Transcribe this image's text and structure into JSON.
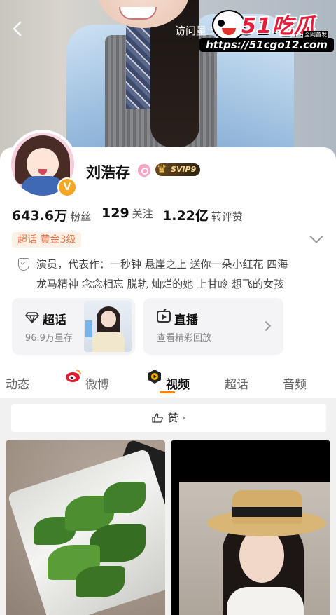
{
  "header": {
    "visits_label": "访问量 5",
    "watermark_brand": "51吃瓜",
    "watermark_tag": "全网首发",
    "watermark_url": "https://51cgo12.com"
  },
  "profile": {
    "name": "刘浩存",
    "svip": "SVIP9",
    "verified_glyph": "V",
    "stats": [
      {
        "value": "643.6万",
        "label": "粉丝"
      },
      {
        "value": "129",
        "label": "关注"
      },
      {
        "value": "1.22亿",
        "label": "转评赞"
      }
    ],
    "level_prefix": "超话",
    "level_text": "黄金3级",
    "bio_line1": "演员，代表作：一秒钟 悬崖之上 送你一朵小红花 四海",
    "bio_line2": "龙马精神 念念相忘 脱轨 灿烂的她 上甘岭 想飞的女孩"
  },
  "cards": {
    "supertopic": {
      "title": "超话",
      "sub": "96.9万星存"
    },
    "live": {
      "title": "直播",
      "sub": "查看精彩回放"
    }
  },
  "tabs": [
    {
      "label": "动态"
    },
    {
      "label": "微博"
    },
    {
      "label": "视频"
    },
    {
      "label": "超话"
    },
    {
      "label": "音频"
    }
  ],
  "like_bar": {
    "label": "赞"
  },
  "colors": {
    "accent": "#ff8200",
    "level_text": "#e8744a",
    "svip_gold": "#f8d98a"
  },
  "icons": [
    "back-icon",
    "more-icon",
    "verified-icon",
    "pink-badge-icon",
    "crown-icon",
    "bio-icon",
    "diamond-icon",
    "live-icon",
    "chevron-right-icon",
    "chevron-down-icon",
    "weibo-icon",
    "video-icon",
    "thumb-up-icon"
  ]
}
